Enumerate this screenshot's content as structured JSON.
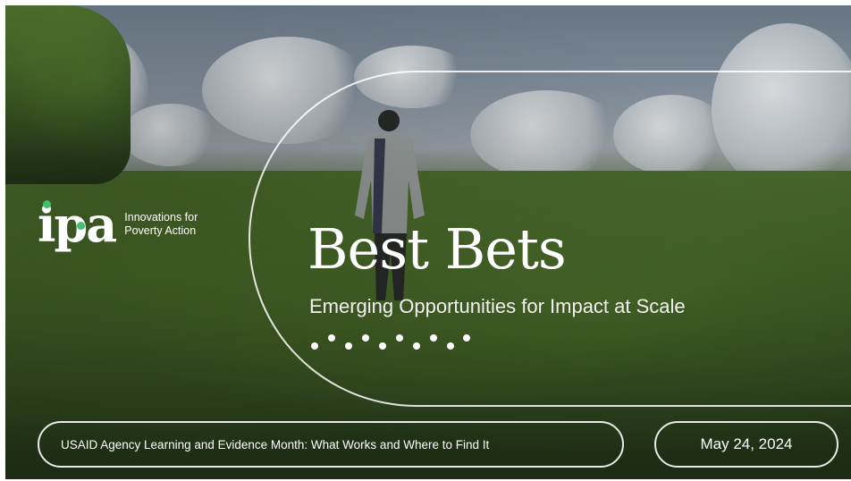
{
  "slide": {
    "title": "Best Bets",
    "subtitle": "Emerging Opportunities for Impact at Scale",
    "event": "USAID Agency Learning and Evidence Month: What Works and Where to Find It",
    "date": "May 24, 2024"
  },
  "logo": {
    "mark": "ipa",
    "name_line1": "Innovations for",
    "name_line2": "Poverty Action",
    "accent_color": "#3fbf6f"
  },
  "colors": {
    "text": "#ffffff",
    "outline": "#ffffff",
    "foliage": "#3f5a25"
  },
  "icons": {
    "decoration": "dotted-wave-decoration",
    "photo_subject": "person-walking-in-field"
  }
}
